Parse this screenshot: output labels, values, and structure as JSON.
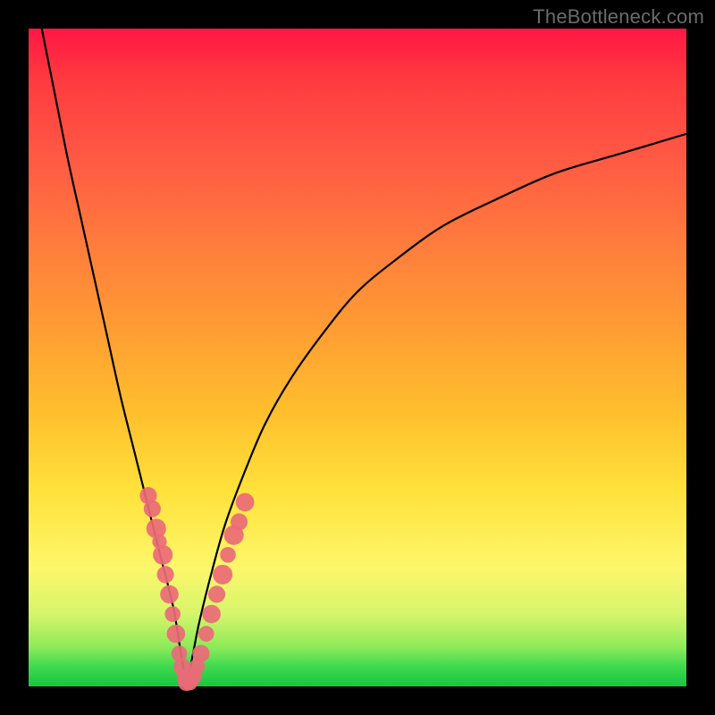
{
  "watermark": "TheBottleneck.com",
  "colors": {
    "frame": "#000000",
    "gradient_top": "#ff1744",
    "gradient_mid": "#ffe13a",
    "gradient_bottom": "#17c63f",
    "curve": "#000000",
    "marker": "#ea6a77"
  },
  "chart_data": {
    "type": "line",
    "title": "",
    "xlabel": "",
    "ylabel": "",
    "xlim": [
      0,
      100
    ],
    "ylim": [
      0,
      100
    ],
    "notch_x": 24,
    "series": [
      {
        "name": "left-branch",
        "x": [
          2,
          4,
          6,
          8,
          10,
          12,
          14,
          16,
          18,
          20,
          22,
          23,
          24
        ],
        "y": [
          100,
          90,
          80,
          71,
          62,
          53,
          44,
          36,
          28,
          20,
          12,
          6,
          0
        ]
      },
      {
        "name": "right-branch",
        "x": [
          24,
          25,
          26,
          28,
          30,
          33,
          36,
          40,
          45,
          50,
          56,
          63,
          71,
          80,
          90,
          100
        ],
        "y": [
          0,
          5,
          10,
          18,
          25,
          33,
          40,
          47,
          54,
          60,
          65,
          70,
          74,
          78,
          81,
          84
        ]
      }
    ],
    "markers": {
      "name": "highlight-points",
      "points": [
        {
          "x": 18.2,
          "y": 29,
          "r": 1.3
        },
        {
          "x": 18.8,
          "y": 27,
          "r": 1.3
        },
        {
          "x": 19.4,
          "y": 24,
          "r": 1.5
        },
        {
          "x": 19.9,
          "y": 22,
          "r": 1.1
        },
        {
          "x": 20.4,
          "y": 20,
          "r": 1.5
        },
        {
          "x": 20.8,
          "y": 17,
          "r": 1.3
        },
        {
          "x": 21.4,
          "y": 14,
          "r": 1.4
        },
        {
          "x": 21.9,
          "y": 11,
          "r": 1.2
        },
        {
          "x": 22.4,
          "y": 8,
          "r": 1.4
        },
        {
          "x": 22.9,
          "y": 5,
          "r": 1.2
        },
        {
          "x": 23.3,
          "y": 3,
          "r": 1.3
        },
        {
          "x": 23.7,
          "y": 1.5,
          "r": 1.2
        },
        {
          "x": 24.0,
          "y": 0.6,
          "r": 1.3
        },
        {
          "x": 24.5,
          "y": 0.6,
          "r": 1.2
        },
        {
          "x": 25.0,
          "y": 1.5,
          "r": 1.3
        },
        {
          "x": 25.6,
          "y": 3,
          "r": 1.2
        },
        {
          "x": 26.2,
          "y": 5,
          "r": 1.3
        },
        {
          "x": 27.0,
          "y": 8,
          "r": 1.2
        },
        {
          "x": 27.8,
          "y": 11,
          "r": 1.4
        },
        {
          "x": 28.6,
          "y": 14,
          "r": 1.3
        },
        {
          "x": 29.5,
          "y": 17,
          "r": 1.5
        },
        {
          "x": 30.3,
          "y": 20,
          "r": 1.2
        },
        {
          "x": 31.2,
          "y": 23,
          "r": 1.5
        },
        {
          "x": 32.0,
          "y": 25,
          "r": 1.3
        },
        {
          "x": 32.9,
          "y": 28,
          "r": 1.4
        }
      ]
    }
  }
}
